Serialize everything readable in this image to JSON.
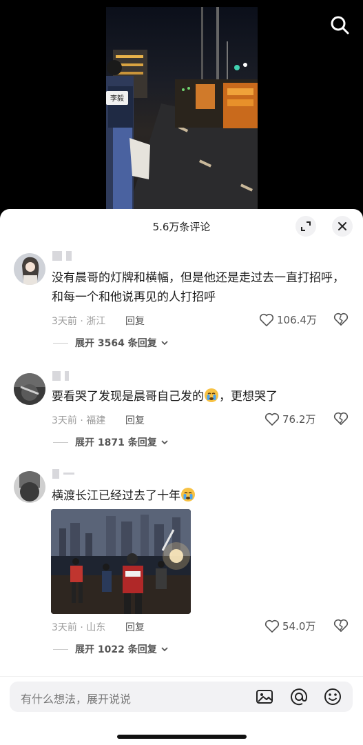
{
  "header": {
    "comment_count": "5.6万条评论"
  },
  "video": {
    "badge_text": "李毅"
  },
  "comments": [
    {
      "text": "没有晨哥的灯牌和横幅，但是他还是走过去一直打招呼，和每一个和他说再见的人打招呼",
      "time_location": "3天前 · 浙江",
      "reply_label": "回复",
      "likes": "106.4万",
      "expand_label": "展开 3564 条回复"
    },
    {
      "text": "要看哭了发现是晨哥自己发的",
      "text_tail": "，更想哭了",
      "time_location": "3天前 · 福建",
      "reply_label": "回复",
      "likes": "76.2万",
      "expand_label": "展开 1871 条回复"
    },
    {
      "text": "横渡长江已经过去了十年",
      "time_location": "3天前 · 山东",
      "reply_label": "回复",
      "likes": "54.0万",
      "expand_label": "展开 1022 条回复"
    }
  ],
  "input": {
    "placeholder": "有什么想法，展开说说"
  },
  "icons": [
    "search-icon",
    "expand-icon",
    "close-icon",
    "heart-icon",
    "broken-heart-icon",
    "image-icon",
    "at-icon",
    "emoji-icon"
  ]
}
